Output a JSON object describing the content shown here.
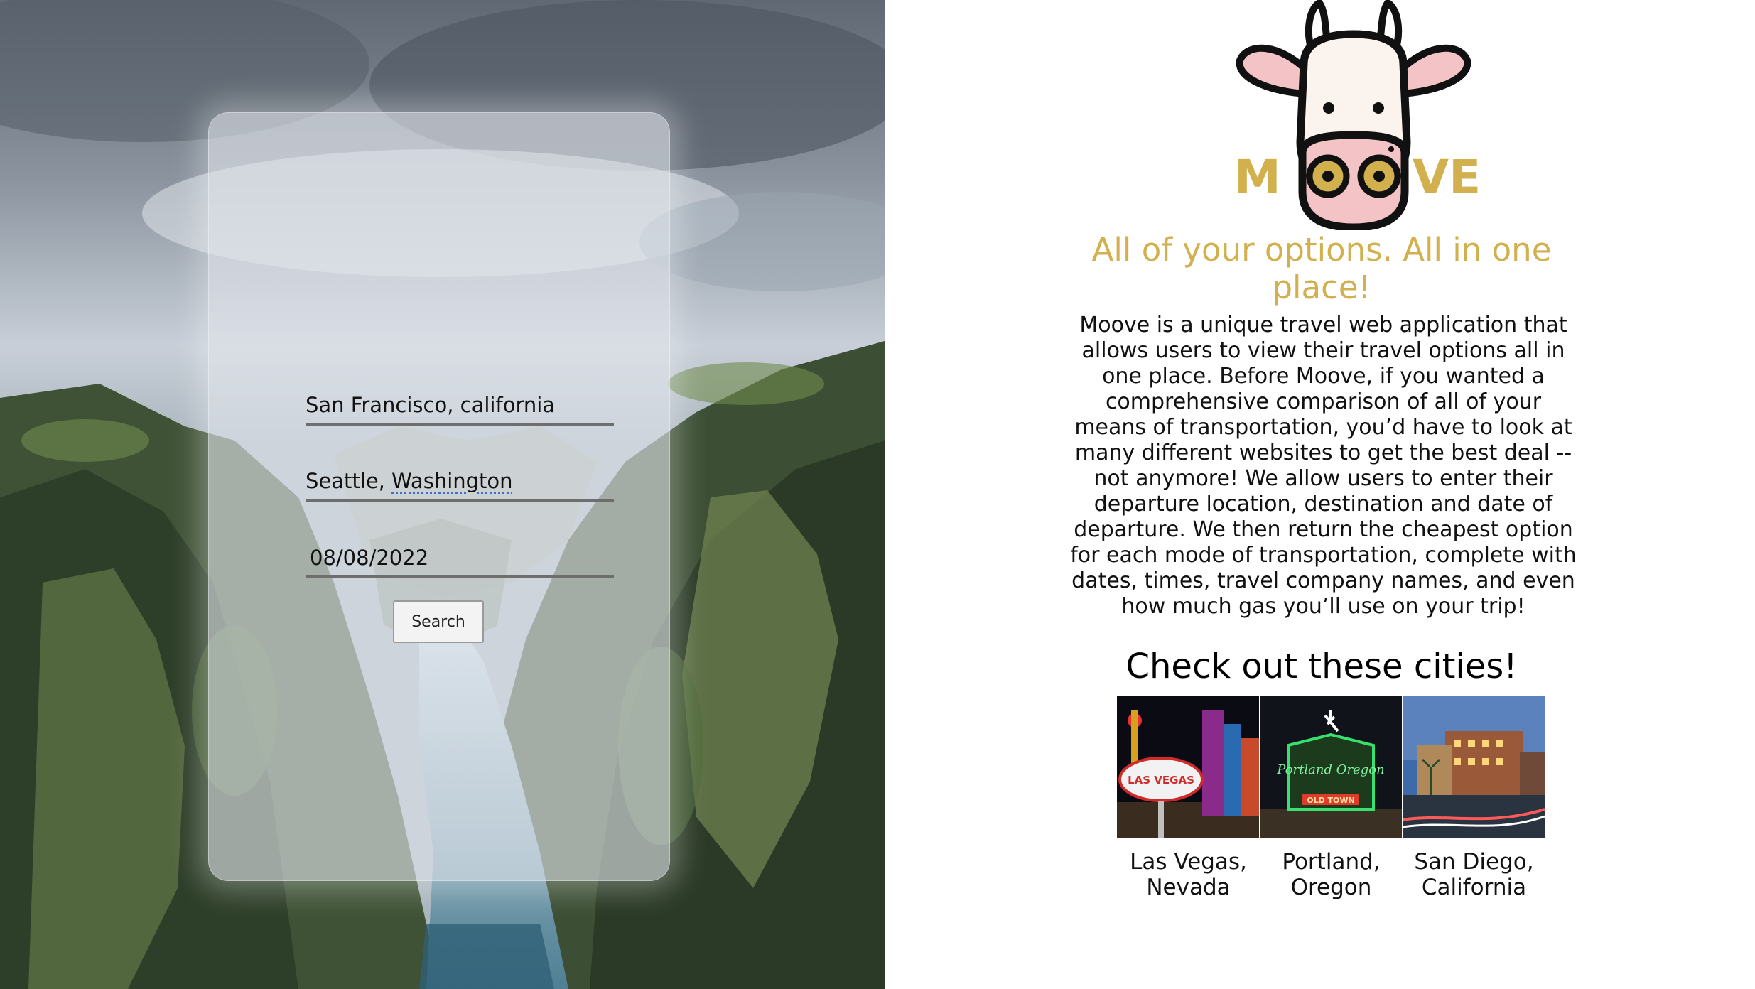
{
  "search_form": {
    "origin_value": "San Francisco, california",
    "destination_city": "Seattle, ",
    "destination_state": "Washington",
    "date_value": "08/08/2022",
    "search_label": "Search"
  },
  "brand": {
    "logo_text": "MOOVE",
    "logo_color": "#d2b04e",
    "tagline": "All of your options. All in one place!",
    "description": "Moove is a unique travel web application that allows users to view their travel options all in one place. Before Moove, if you wanted a comprehensive comparison of all of your means of transportation, you’d have to look at many different websites to get the best deal -- not anymore! We allow users to enter their departure location, destination and date of departure. We then return the cheapest option for each mode of transportation, complete with dates, times, travel company names, and even how much gas you’ll use on your trip!"
  },
  "cities_section": {
    "heading": "Check out these cities!",
    "cities": [
      {
        "name": "Las Vegas, Nevada",
        "sign_text": "LAS VEGAS"
      },
      {
        "name": "Portland, Oregon",
        "sign_text": "Portland Oregon",
        "sign_subtext": "OLD TOWN"
      },
      {
        "name": "San Diego, California"
      }
    ]
  }
}
